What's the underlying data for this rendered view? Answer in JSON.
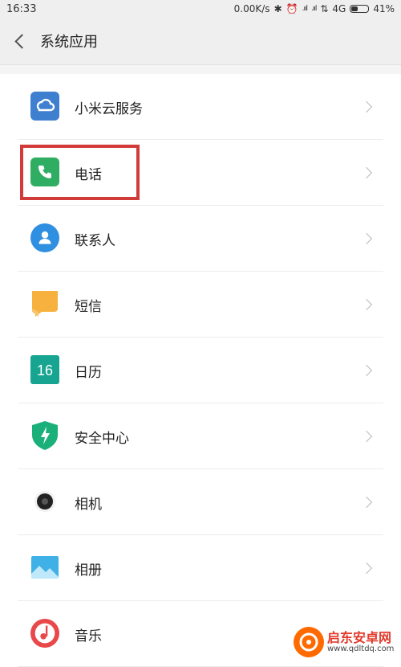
{
  "status_bar": {
    "time": "16:33",
    "net_speed": "0.00K/s",
    "signal_1": ".ııl",
    "signal_2": ".ııl",
    "network_type": "4G",
    "battery_percent": "41%",
    "battery_level": 0.41
  },
  "header": {
    "title": "系统应用"
  },
  "items": [
    {
      "label": "小米云服务",
      "icon": "cloud-icon",
      "color": "#3f7fd0"
    },
    {
      "label": "电话",
      "icon": "phone-icon",
      "color": "#2fae63"
    },
    {
      "label": "联系人",
      "icon": "contact-icon",
      "color": "#2f8fe0"
    },
    {
      "label": "短信",
      "icon": "message-icon",
      "color": "#f6b13e"
    },
    {
      "label": "日历",
      "icon": "calendar-icon",
      "color": "#17a592",
      "badge": "16"
    },
    {
      "label": "安全中心",
      "icon": "shield-icon",
      "color": "#1bb07a"
    },
    {
      "label": "相机",
      "icon": "camera-icon",
      "color": "#222222"
    },
    {
      "label": "相册",
      "icon": "gallery-icon",
      "color": "#3fb1e6"
    },
    {
      "label": "音乐",
      "icon": "music-icon",
      "color": "#e8484a"
    }
  ],
  "highlight_color": "#d33a3a",
  "watermark": {
    "title": "启东安卓网",
    "url": "www.qdltdq.com"
  }
}
